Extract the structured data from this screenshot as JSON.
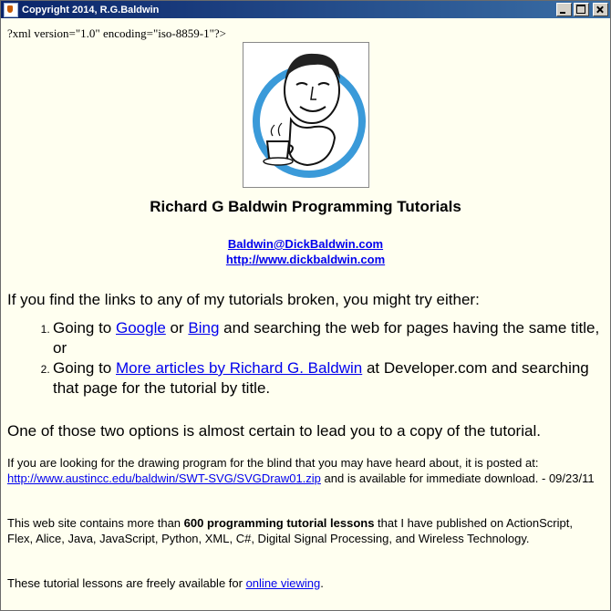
{
  "window": {
    "title": "Copyright 2014, R.G.Baldwin"
  },
  "xml_declaration": "?xml version=\"1.0\" encoding=\"iso-8859-1\"?>",
  "header": {
    "heading": "Richard G Baldwin Programming Tutorials",
    "email_link": "Baldwin@DickBaldwin.com",
    "website_link": "http://www.dickbaldwin.com"
  },
  "intro": "If you find the links to any of my tutorials broken, you might try either:",
  "options": [
    {
      "prefix": "Going to ",
      "link1": "Google",
      "mid": " or ",
      "link2": "Bing",
      "suffix": " and searching the web for pages having the same title, or"
    },
    {
      "prefix": "Going to ",
      "link1": "More articles by Richard G. Baldwin",
      "suffix": " at Developer.com and searching that page for the tutorial by title."
    }
  ],
  "outro": "One of those two options is almost certain to lead you to a copy of the tutorial.",
  "drawing_para": {
    "text1": "If you are looking for the drawing program for the blind that you may have heard about, it is posted at: ",
    "link": "http://www.austincc.edu/baldwin/SWT-SVG/SVGDraw01.zip",
    "text2": " and is available for immediate download. - 09/23/11"
  },
  "lessons_para": {
    "text1": "This web site contains more than ",
    "bold": "600 programming tutorial lessons",
    "text2": " that I have published on ActionScript, Flex, Alice, Java, JavaScript, Python, XML, C#, Digital Signal Processing, and Wireless Technology."
  },
  "free_para": {
    "text1": "These tutorial lessons are freely available for ",
    "link": "online viewing",
    "text2": "."
  }
}
